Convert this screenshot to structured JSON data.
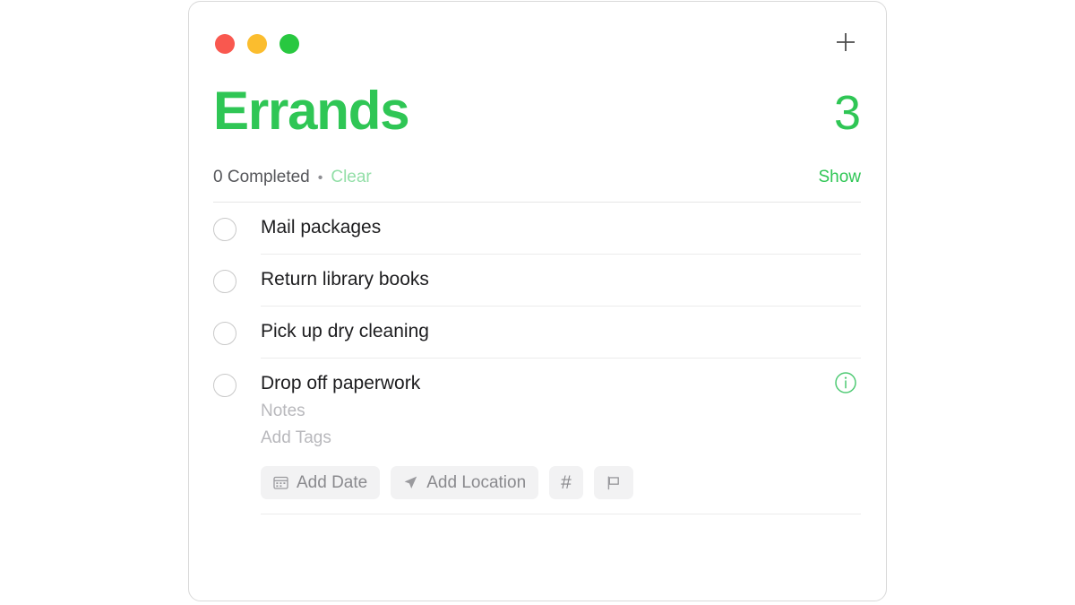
{
  "window": {
    "traffic_lights": [
      {
        "name": "close",
        "color": "#f9584f"
      },
      {
        "name": "minimize",
        "color": "#fbbd2e"
      },
      {
        "name": "maximize",
        "color": "#28c840"
      }
    ],
    "add_button_icon": "plus-icon"
  },
  "colors": {
    "accent_green": "#2fc655",
    "muted_green": "#93dfa8",
    "title_text": "#1d1d1f",
    "secondary_text": "#55565a",
    "placeholder_text": "#b8b8bc",
    "chip_background": "#f2f2f3",
    "divider": "#ececec"
  },
  "list": {
    "title": "Errands",
    "count": "3",
    "completed_label": "0 Completed",
    "separator": "•",
    "clear_label": "Clear",
    "show_label": "Show"
  },
  "reminders": [
    {
      "title": "Mail packages",
      "checked": false
    },
    {
      "title": "Return library books",
      "checked": false
    },
    {
      "title": "Pick up dry cleaning",
      "checked": false
    }
  ],
  "expanded_reminder": {
    "title": "Drop off paperwork",
    "checked": false,
    "notes_placeholder": "Notes",
    "tags_placeholder": "Add Tags",
    "info_icon": "info-circle-icon",
    "chips": [
      {
        "label": "Add Date",
        "icon": "calendar-icon"
      },
      {
        "label": "Add Location",
        "icon": "location-arrow-icon"
      },
      {
        "label": "#",
        "icon": "hashtag-icon"
      },
      {
        "label": "",
        "icon": "flag-icon"
      }
    ]
  }
}
